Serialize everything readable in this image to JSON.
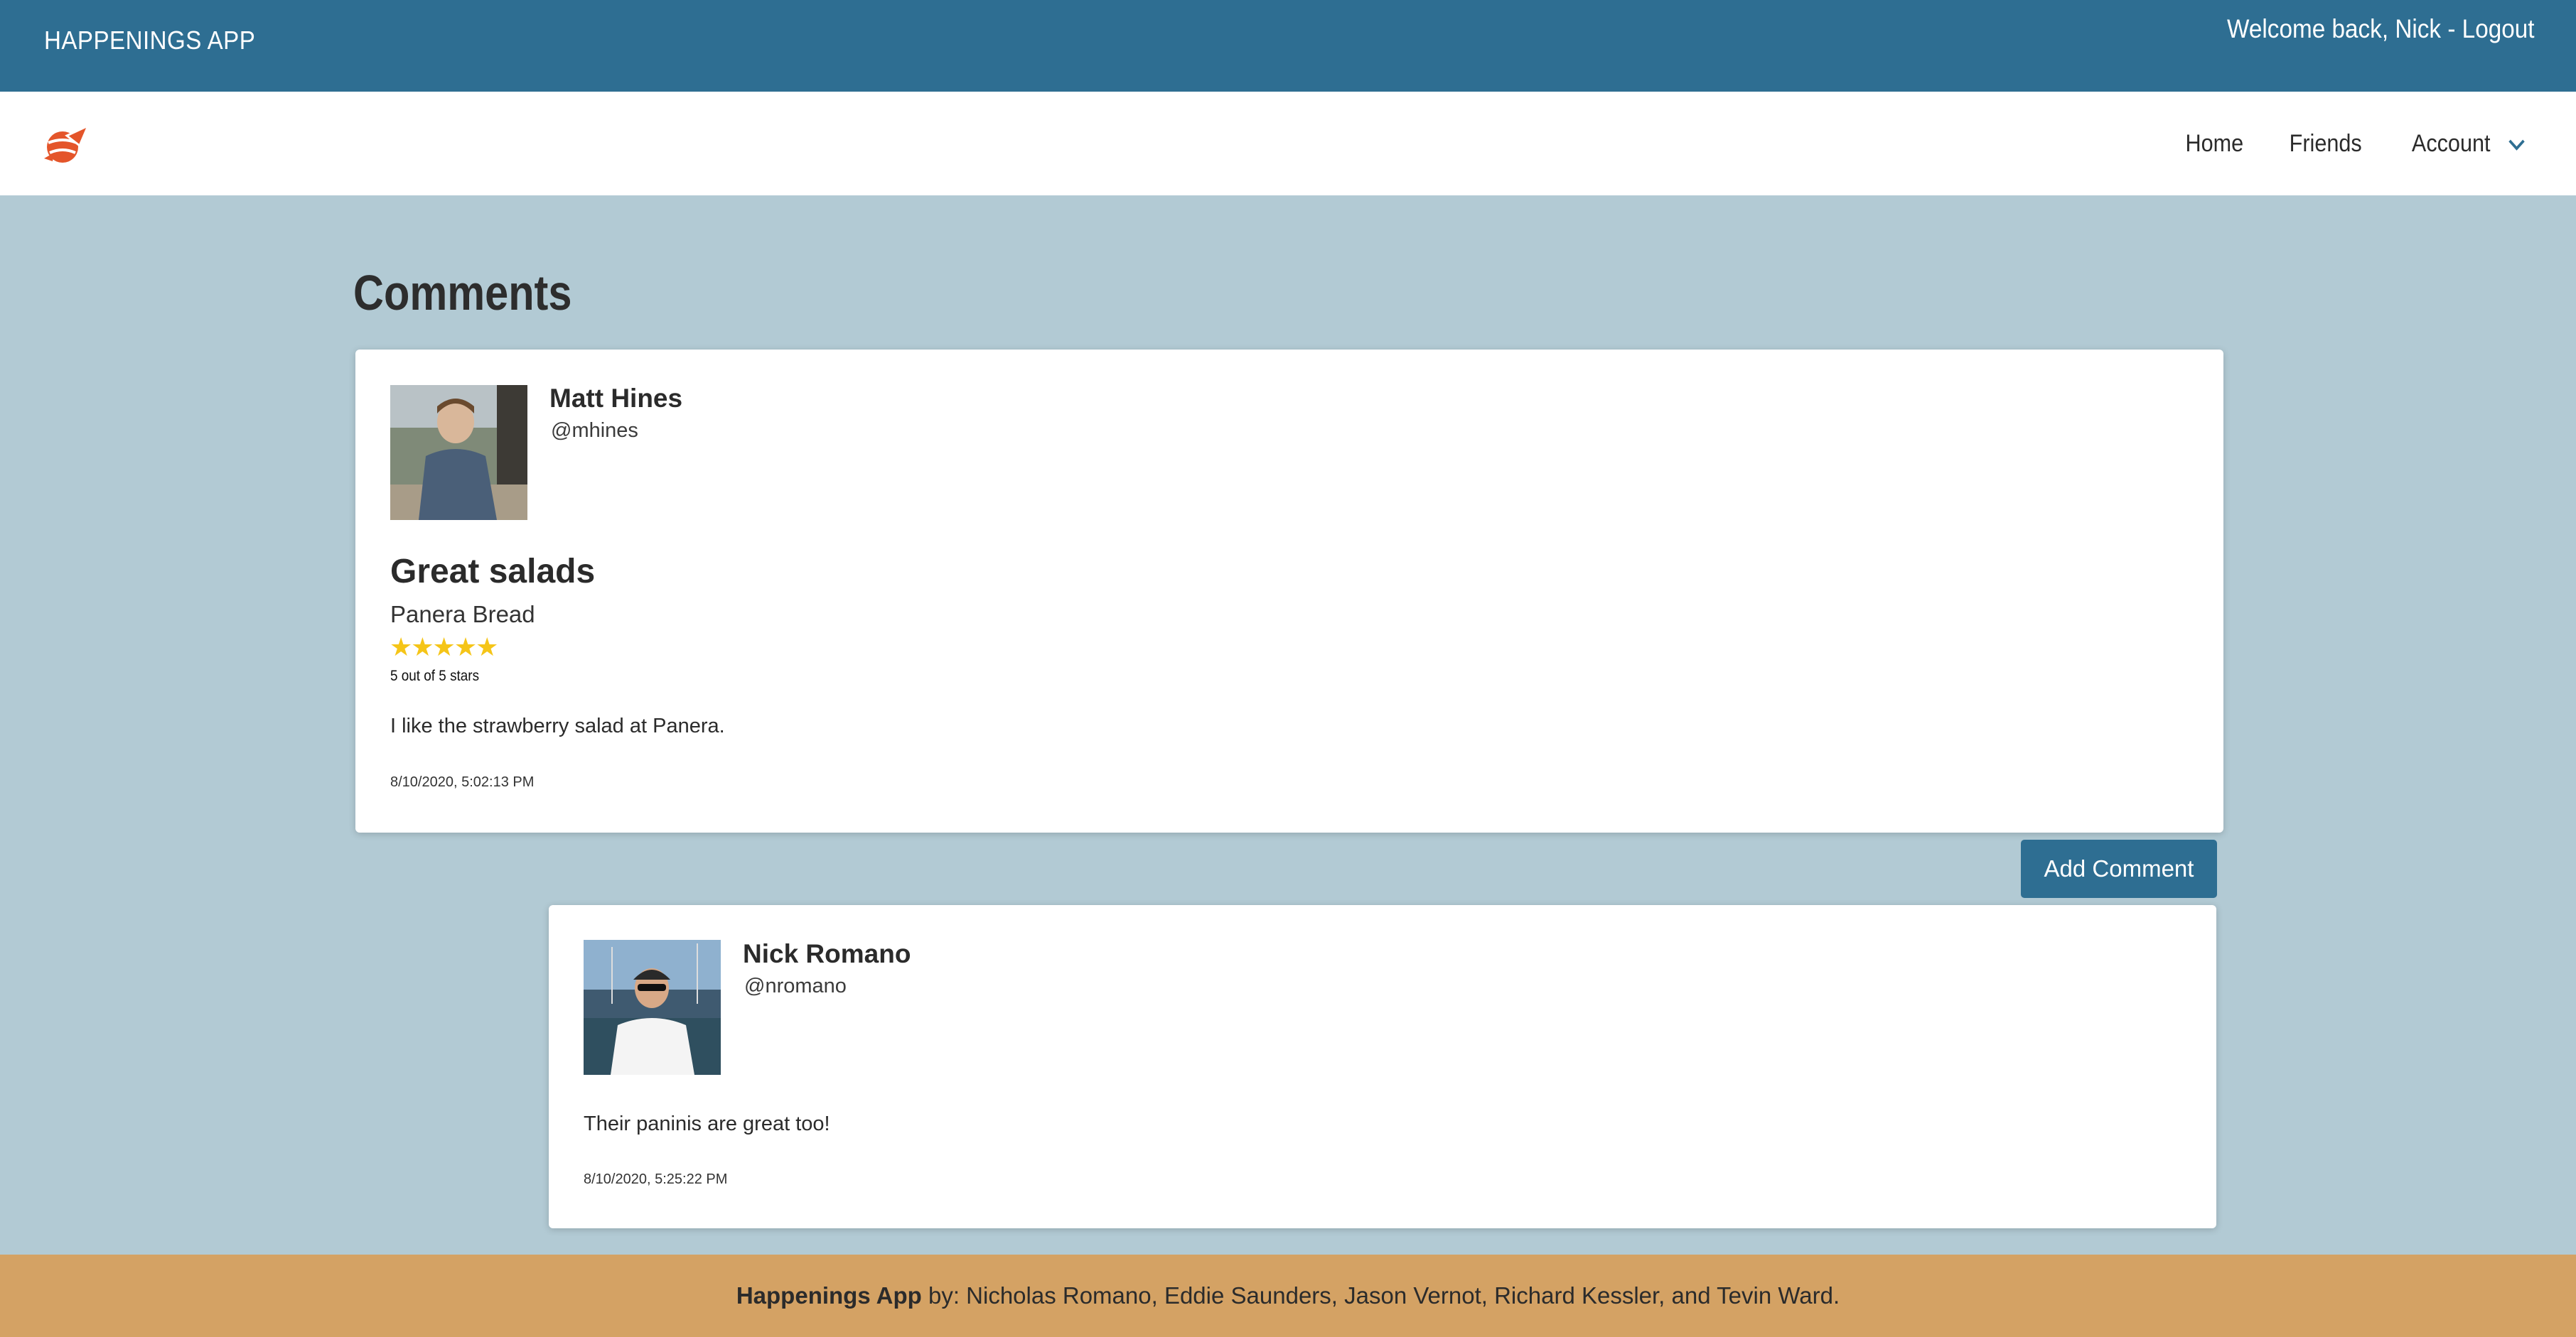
{
  "topbar": {
    "app_title": "HAPPENINGS APP",
    "welcome_text": "Welcome back, Nick - ",
    "logout_label": "Logout",
    "color": "#2e6e92"
  },
  "navbar": {
    "logo_icon": "rocket-globe-logo-icon",
    "links": {
      "home": "Home",
      "friends": "Friends",
      "account": "Account"
    }
  },
  "page": {
    "title": "Comments",
    "background": "#b2cad4"
  },
  "review": {
    "user_name": "Matt Hines",
    "handle": "@mhines",
    "title": "Great salads",
    "place": "Panera Bread",
    "stars_display": "★★★★★",
    "rating": 5,
    "rating_text": "5 out of 5 stars",
    "body": "I like the strawberry salad at Panera.",
    "timestamp": "8/10/2020, 5:02:13 PM"
  },
  "add_comment_label": "Add Comment",
  "comments": [
    {
      "user_name": "Nick Romano",
      "handle": "@nromano",
      "body": "Their paninis are great too!",
      "timestamp": "8/10/2020, 5:25:22 PM"
    }
  ],
  "footer": {
    "app_name": "Happenings App",
    "credits": " by: Nicholas Romano, Eddie Saunders, Jason Vernot, Richard Kessler, and Tevin Ward.",
    "color": "#d4a264"
  }
}
